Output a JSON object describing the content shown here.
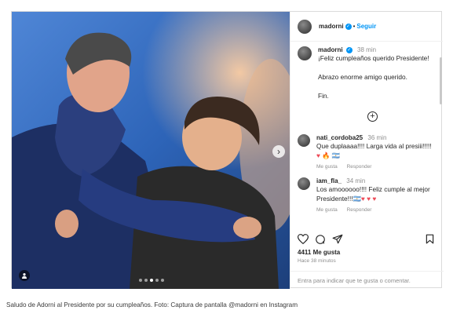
{
  "post": {
    "username": "madorni",
    "follow_label": "Seguir",
    "verified_symbol": "✓",
    "photo": {
      "slide_count": 5,
      "active_slide": 3,
      "next_arrow": "›"
    },
    "caption_comment": {
      "username": "madorni",
      "time": "38 min",
      "lines": [
        "¡Feliz cumpleaños querido Presidente!",
        "Abrazo enorme amigo querido.",
        "Fin."
      ]
    },
    "load_more_symbol": "+",
    "comments": [
      {
        "username": "nati_cordoba25",
        "time": "36 min",
        "text": "Que duplaaaa!!!! Larga vida al presiii!!!!!",
        "emoji": "♥ 🔥 🇦🇷",
        "likes_label": "Me gusta",
        "reply_label": "Responder"
      },
      {
        "username": "iam_fla_",
        "time": "34 min",
        "text": "Los amoooooo!!!! Feliz cumple al mejor Presidente!!!",
        "emoji": "🇦🇷♥ ♥ ♥",
        "likes_label": "Me gusta",
        "reply_label": "Responder"
      }
    ],
    "likes_count": "4411 Me gusta",
    "posted_ago": "Hace 38 minutos",
    "add_comment_placeholder": "Entra para indicar que te gusta o comentar."
  },
  "caption": "Saludo de Adorni al Presidente por su cumpleaños. Foto: Captura de pantalla @madorni en Instagram",
  "icons": [
    "heart-icon",
    "comment-icon",
    "share-icon",
    "bookmark-icon",
    "tag-user-icon"
  ],
  "colors": {
    "link_blue": "#0095f6",
    "muted_text": "#8e8e8e",
    "border": "#dbdbdb"
  }
}
